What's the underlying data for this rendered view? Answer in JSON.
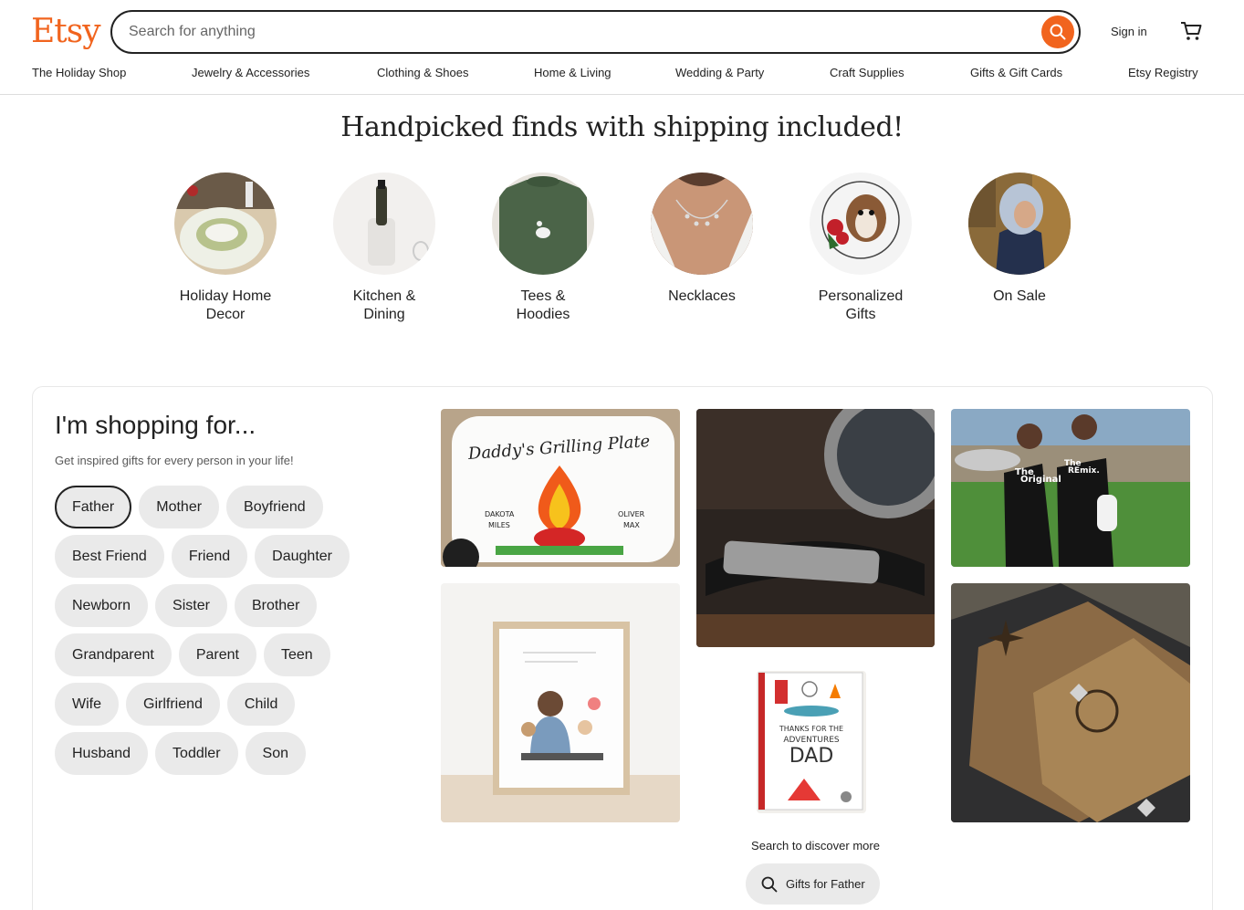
{
  "header": {
    "logo": "Etsy",
    "search_placeholder": "Search for anything",
    "sign_in": "Sign in",
    "brand_color": "#F1641E"
  },
  "nav": {
    "items": [
      "The Holiday Shop",
      "Jewelry & Accessories",
      "Clothing & Shoes",
      "Home & Living",
      "Wedding & Party",
      "Craft Supplies",
      "Gifts & Gift Cards",
      "Etsy Registry"
    ]
  },
  "hero": {
    "title": "Handpicked finds with shipping included!",
    "categories": [
      {
        "label": "Holiday Home\nDecor"
      },
      {
        "label": "Kitchen &\nDining"
      },
      {
        "label": "Tees &\nHoodies"
      },
      {
        "label": "Necklaces"
      },
      {
        "label": "Personalized\nGifts"
      },
      {
        "label": "On Sale"
      }
    ]
  },
  "shopping": {
    "title": "I'm shopping for...",
    "subtitle": "Get inspired gifts for every person in your life!",
    "chips": [
      [
        "Father",
        "Mother",
        "Boyfriend"
      ],
      [
        "Best Friend",
        "Friend",
        "Daughter"
      ],
      [
        "Newborn",
        "Sister",
        "Brother"
      ],
      [
        "Grandparent",
        "Parent",
        "Teen"
      ],
      [
        "Wife",
        "Girlfriend",
        "Child"
      ],
      [
        "Husband",
        "Toddler",
        "Son"
      ]
    ],
    "active_chip": "Father",
    "tiles": {
      "plate_title": "Daddy's Grilling Plate",
      "plate_names_left": [
        "DAKOTA",
        "MILES"
      ],
      "plate_names_right": [
        "OLIVER",
        "MAX"
      ],
      "card_text": [
        "THANKS FOR THE",
        "ADVENTURES",
        "DAD"
      ],
      "shirt_left": [
        "The",
        "Original"
      ],
      "shirt_right": [
        "The",
        "REmix."
      ]
    },
    "discover": "Search to discover more",
    "gifts_button": "Gifts for Father"
  }
}
